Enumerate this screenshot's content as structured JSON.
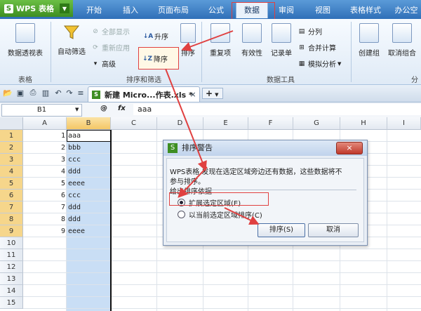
{
  "app": {
    "name": "WPS 表格",
    "logo": "S"
  },
  "menu": [
    "开始",
    "插入",
    "页面布局",
    "公式",
    "数据",
    "审阅",
    "视图",
    "表格样式",
    "办公空"
  ],
  "ribbon": {
    "pivot": "数据透视表",
    "group_table": "表格",
    "autofilter": "自动筛选",
    "show_all": "全部显示",
    "reapply": "重新应用",
    "advanced": "高级",
    "sort_asc": "升序",
    "sort_desc": "降序",
    "sort": "排序",
    "group_sortfilter": "排序和筛选",
    "duplicates": "重复项",
    "validity": "有效性",
    "records": "记录单",
    "split": "分列",
    "merge_calc": "合并计算",
    "simulate": "模拟分析",
    "group_datatools": "数据工具",
    "create_group": "创建组",
    "ungroup": "取消组合",
    "outline_more": "分"
  },
  "doctab": {
    "title": "新建 Micro...作表.xls *",
    "close": "×",
    "new": "+"
  },
  "formula_bar": {
    "cell_ref": "B1",
    "zoom_icon": "@",
    "fx": "fx",
    "value": "aaa"
  },
  "columns": [
    "A",
    "B",
    "C",
    "D",
    "E",
    "F",
    "G",
    "H",
    "I"
  ],
  "rows": [
    "1",
    "2",
    "3",
    "4",
    "5",
    "6",
    "7",
    "8",
    "9",
    "10",
    "11",
    "12",
    "13",
    "14",
    "15"
  ],
  "col_a_values": [
    "1",
    "2",
    "3",
    "4",
    "5",
    "6",
    "7",
    "8",
    "9"
  ],
  "col_b_values": [
    "aaa",
    "bbb",
    "ccc",
    "ddd",
    "eeee",
    "ccc",
    "ddd",
    "ddd",
    "eeee"
  ],
  "dialog": {
    "title": "排序警告",
    "message_line1": "WPS表格 发现在选定区域旁边还有数据，这些数据将不",
    "message_line2": "参与排序。",
    "basis_label": "给出排序依据",
    "option_expand": "扩展选定区域(E)",
    "option_current": "以当前选定区域排序(C)",
    "sort_button": "排序(S)",
    "cancel_button": "取消",
    "close": "×"
  },
  "colors": {
    "accent_red": "#e04040",
    "menubar": "#3d7cc4",
    "selection": "#c9def5"
  }
}
